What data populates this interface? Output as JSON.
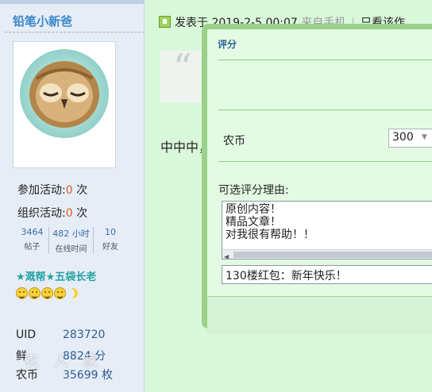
{
  "profile": {
    "username": "铅笔小新爸",
    "activity": [
      {
        "label": "参加活动:",
        "value": "0",
        "unit": "次"
      },
      {
        "label": "组织活动:",
        "value": "0",
        "unit": "次"
      }
    ],
    "mini_stats": [
      {
        "value": "3464",
        "label": "帖子"
      },
      {
        "value": "482 小时",
        "label": "在线时间"
      },
      {
        "value": "10",
        "label": "好友"
      }
    ],
    "group": "★溉帮★五袋长老",
    "details": [
      {
        "key": "UID",
        "value": "283720"
      },
      {
        "key": "鲜",
        "value": "8824 分"
      },
      {
        "key": "农币",
        "value": "35699 枚"
      }
    ]
  },
  "post": {
    "meta": "发表于 2019-2-5 00:07",
    "from": "来自手机",
    "separator": "|",
    "view_only": "只看该作",
    "quote_mark": "“",
    "body": "中中中，"
  },
  "rating_dialog": {
    "title": "评分",
    "coin_label": "农币",
    "coin_value": "300",
    "reason_label": "可选评分理由:",
    "reasons": [
      "原创内容！",
      "精品文章！",
      "对我很有帮助！！"
    ],
    "reason_input": "130楼红包：新年快乐！"
  },
  "watermark": "农 人 家"
}
